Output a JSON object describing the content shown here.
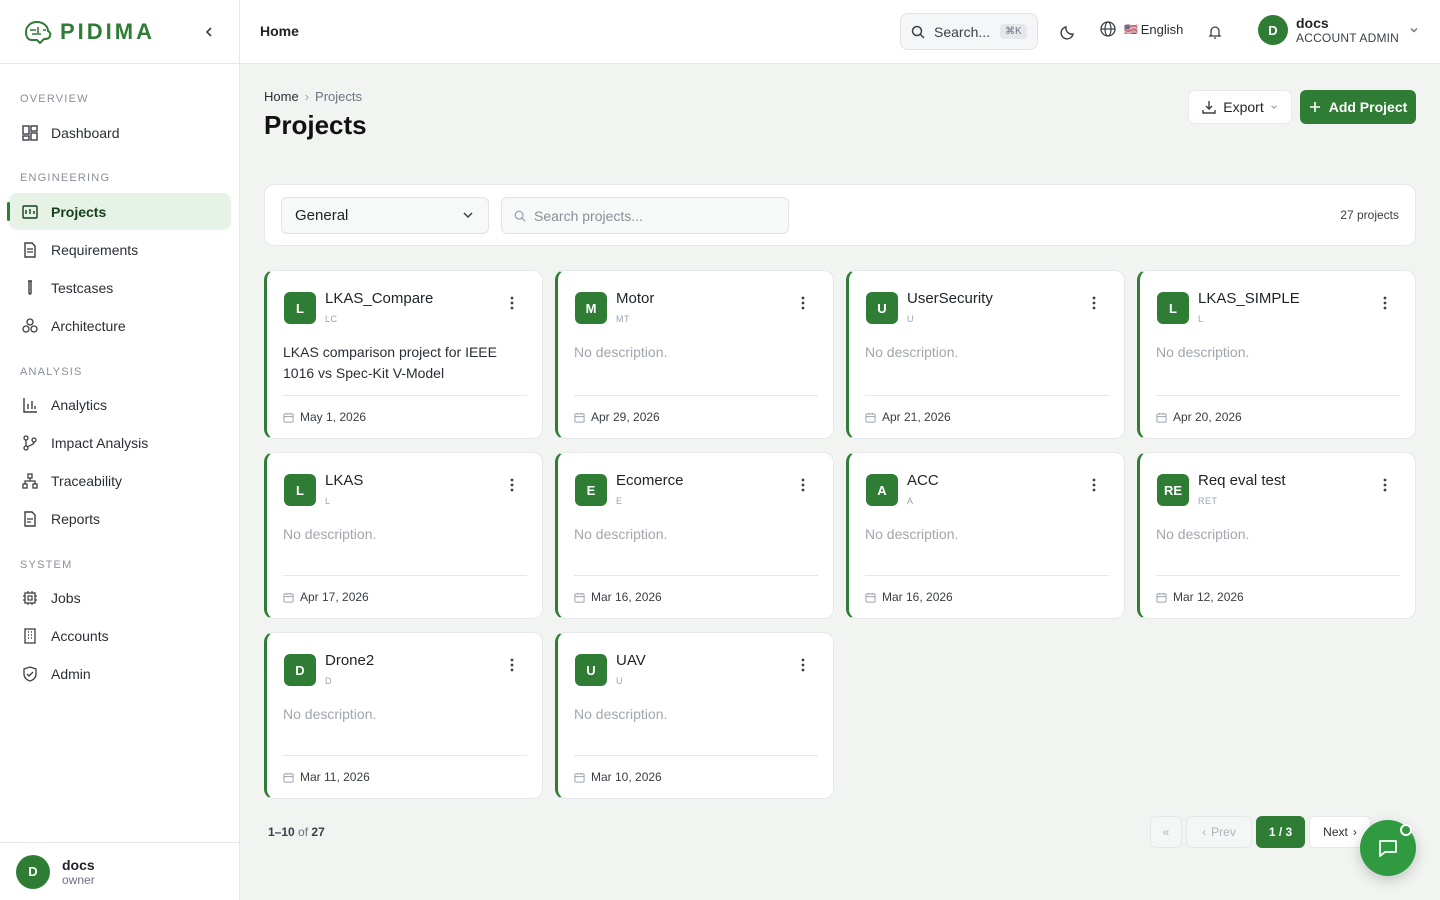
{
  "brand": {
    "name": "PIDIMA"
  },
  "nav": {
    "sections": [
      {
        "label": "OVERVIEW",
        "items": [
          {
            "label": "Dashboard",
            "icon": "dashboard-icon"
          }
        ]
      },
      {
        "label": "ENGINEERING",
        "items": [
          {
            "label": "Projects",
            "icon": "projects-icon",
            "active": true
          },
          {
            "label": "Requirements",
            "icon": "document-icon"
          },
          {
            "label": "Testcases",
            "icon": "test-tube-icon"
          },
          {
            "label": "Architecture",
            "icon": "architecture-icon"
          }
        ]
      },
      {
        "label": "ANALYSIS",
        "items": [
          {
            "label": "Analytics",
            "icon": "bar-chart-icon"
          },
          {
            "label": "Impact Analysis",
            "icon": "branch-icon"
          },
          {
            "label": "Traceability",
            "icon": "network-icon"
          },
          {
            "label": "Reports",
            "icon": "report-icon"
          }
        ]
      },
      {
        "label": "SYSTEM",
        "items": [
          {
            "label": "Jobs",
            "icon": "cpu-icon"
          },
          {
            "label": "Accounts",
            "icon": "building-icon"
          },
          {
            "label": "Admin",
            "icon": "shield-icon"
          }
        ]
      }
    ]
  },
  "sidebar_user": {
    "initial": "D",
    "name": "docs",
    "role": "owner"
  },
  "topbar": {
    "breadcrumb": "Home",
    "search_label": "Search...",
    "search_shortcut": "⌘K",
    "language": "English",
    "language_flag": "🇺🇸",
    "user": {
      "initial": "D",
      "name": "docs",
      "role": "ACCOUNT ADMIN"
    }
  },
  "page": {
    "breadcrumb_home": "Home",
    "breadcrumb_current": "Projects",
    "title": "Projects",
    "export_label": "Export",
    "add_label": "Add Project"
  },
  "filters": {
    "group_selected": "General",
    "search_placeholder": "Search projects...",
    "count_text": "27 projects"
  },
  "projects": [
    {
      "badge": "L",
      "name": "LKAS_Compare",
      "key": "LC",
      "description": "LKAS comparison project for IEEE 1016 vs Spec-Kit V-Model",
      "date": "May 1, 2026"
    },
    {
      "badge": "M",
      "name": "Motor",
      "key": "MT",
      "description": "No description.",
      "date": "Apr 29, 2026"
    },
    {
      "badge": "U",
      "name": "UserSecurity",
      "key": "U",
      "description": "No description.",
      "date": "Apr 21, 2026"
    },
    {
      "badge": "L",
      "name": "LKAS_SIMPLE",
      "key": "L",
      "description": "No description.",
      "date": "Apr 20, 2026"
    },
    {
      "badge": "L",
      "name": "LKAS",
      "key": "L",
      "description": "No description.",
      "date": "Apr 17, 2026"
    },
    {
      "badge": "E",
      "name": "Ecomerce",
      "key": "E",
      "description": "No description.",
      "date": "Mar 16, 2026"
    },
    {
      "badge": "A",
      "name": "ACC",
      "key": "A",
      "description": "No description.",
      "date": "Mar 16, 2026"
    },
    {
      "badge": "RE",
      "name": "Req eval test",
      "key": "RET",
      "description": "No description.",
      "date": "Mar 12, 2026"
    },
    {
      "badge": "D",
      "name": "Drone2",
      "key": "D",
      "description": "No description.",
      "date": "Mar 11, 2026"
    },
    {
      "badge": "U",
      "name": "UAV",
      "key": "U",
      "description": "No description.",
      "date": "Mar 10, 2026"
    }
  ],
  "pagination": {
    "range": "1–10",
    "of_label": "of",
    "total": "27",
    "first_label": "«",
    "prev_label": "Prev",
    "current": "1 / 3",
    "next_label": "Next"
  },
  "colors": {
    "accent": "#2f7d34",
    "accent_light": "#e6f2e6",
    "fab": "#2f9a3f"
  }
}
